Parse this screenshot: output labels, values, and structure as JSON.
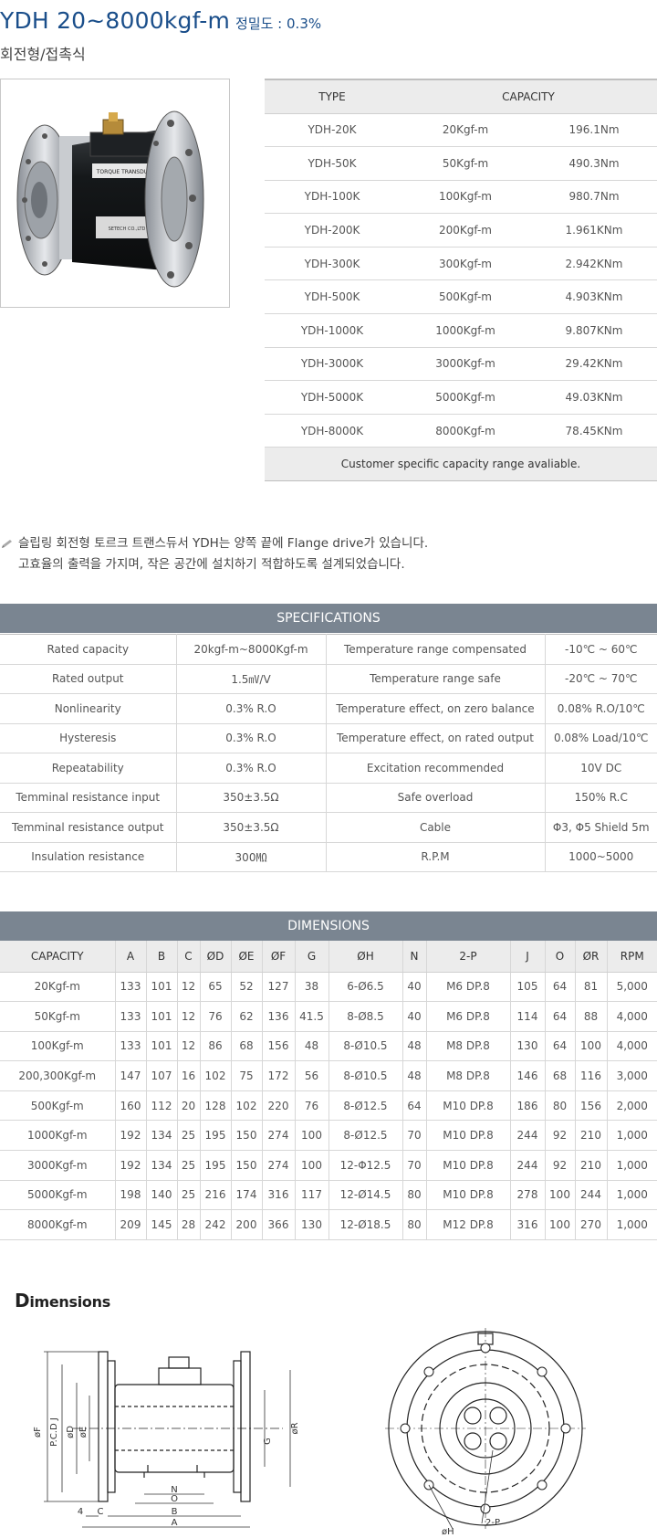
{
  "header": {
    "title": "YDH 20~8000kgf-m",
    "accuracy": "정밀도 : 0.3%",
    "subtitle": "회전형/접촉식"
  },
  "photo": {
    "label_top": "TORQUE TRANSDUCER",
    "label_bottom": "SETECH CO.,LTD"
  },
  "capacity_table": {
    "headers": [
      "TYPE",
      "CAPACITY"
    ],
    "rows": [
      [
        "YDH-20K",
        "20Kgf-m",
        "196.1Nm"
      ],
      [
        "YDH-50K",
        "50Kgf-m",
        "490.3Nm"
      ],
      [
        "YDH-100K",
        "100Kgf-m",
        "980.7Nm"
      ],
      [
        "YDH-200K",
        "200Kgf-m",
        "1.961KNm"
      ],
      [
        "YDH-300K",
        "300Kgf-m",
        "2.942KNm"
      ],
      [
        "YDH-500K",
        "500Kgf-m",
        "4.903KNm"
      ],
      [
        "YDH-1000K",
        "1000Kgf-m",
        "9.807KNm"
      ],
      [
        "YDH-3000K",
        "3000Kgf-m",
        "29.42KNm"
      ],
      [
        "YDH-5000K",
        "5000Kgf-m",
        "49.03KNm"
      ],
      [
        "YDH-8000K",
        "8000Kgf-m",
        "78.45KNm"
      ]
    ],
    "footer": "Customer specific capacity range avaliable."
  },
  "intro": {
    "line1": "슬립링 회전형 토르크 트랜스듀서 YDH는 양쪽 끝에 Flange drive가 있습니다.",
    "line2": "고효율의 출력을 가지며, 작은 공간에 설치하기 적합하도록 설계되었습니다."
  },
  "specifications": {
    "title": "SPECIFICATIONS",
    "rows": [
      [
        "Rated capacity",
        "20kgf-m~8000Kgf-m",
        "Temperature range compensated",
        "-10℃ ~ 60℃"
      ],
      [
        "Rated output",
        "1.5㎷/V",
        "Temperature range safe",
        "-20℃ ~ 70℃"
      ],
      [
        "Nonlinearity",
        "0.3% R.O",
        "Temperature effect, on zero balance",
        "0.08% R.O/10℃"
      ],
      [
        "Hysteresis",
        "0.3% R.O",
        "Temperature effect, on rated output",
        "0.08% Load/10℃"
      ],
      [
        "Repeatability",
        "0.3% R.O",
        "Excitation recommended",
        "10V DC"
      ],
      [
        "Temminal resistance input",
        "350±3.5Ω",
        "Safe overload",
        "150% R.C"
      ],
      [
        "Temminal resistance output",
        "350±3.5Ω",
        "Cable",
        "Φ3, Φ5 Shield 5m"
      ],
      [
        "Insulation resistance",
        "300㏁",
        "R.P.M",
        "1000~5000"
      ]
    ]
  },
  "dimensions": {
    "title": "DIMENSIONS",
    "headers": [
      "CAPACITY",
      "A",
      "B",
      "C",
      "ØD",
      "ØE",
      "ØF",
      "G",
      "ØH",
      "N",
      "2-P",
      "J",
      "O",
      "ØR",
      "RPM"
    ],
    "rows": [
      [
        "20Kgf-m",
        "133",
        "101",
        "12",
        "65",
        "52",
        "127",
        "38",
        "6-Ø6.5",
        "40",
        "M6 DP.8",
        "105",
        "64",
        "81",
        "5,000"
      ],
      [
        "50Kgf-m",
        "133",
        "101",
        "12",
        "76",
        "62",
        "136",
        "41.5",
        "8-Ø8.5",
        "40",
        "M6 DP.8",
        "114",
        "64",
        "88",
        "4,000"
      ],
      [
        "100Kgf-m",
        "133",
        "101",
        "12",
        "86",
        "68",
        "156",
        "48",
        "8-Ø10.5",
        "48",
        "M8 DP.8",
        "130",
        "64",
        "100",
        "4,000"
      ],
      [
        "200,300Kgf-m",
        "147",
        "107",
        "16",
        "102",
        "75",
        "172",
        "56",
        "8-Ø10.5",
        "48",
        "M8 DP.8",
        "146",
        "68",
        "116",
        "3,000"
      ],
      [
        "500Kgf-m",
        "160",
        "112",
        "20",
        "128",
        "102",
        "220",
        "76",
        "8-Ø12.5",
        "64",
        "M10 DP.8",
        "186",
        "80",
        "156",
        "2,000"
      ],
      [
        "1000Kgf-m",
        "192",
        "134",
        "25",
        "195",
        "150",
        "274",
        "100",
        "8-Ø12.5",
        "70",
        "M10 DP.8",
        "244",
        "92",
        "210",
        "1,000"
      ],
      [
        "3000Kgf-m",
        "192",
        "134",
        "25",
        "195",
        "150",
        "274",
        "100",
        "12-Φ12.5",
        "70",
        "M10 DP.8",
        "244",
        "92",
        "210",
        "1,000"
      ],
      [
        "5000Kgf-m",
        "198",
        "140",
        "25",
        "216",
        "174",
        "316",
        "117",
        "12-Ø14.5",
        "80",
        "M10 DP.8",
        "278",
        "100",
        "244",
        "1,000"
      ],
      [
        "8000Kgf-m",
        "209",
        "145",
        "28",
        "242",
        "200",
        "366",
        "130",
        "12-Ø18.5",
        "80",
        "M12 DP.8",
        "316",
        "100",
        "270",
        "1,000"
      ]
    ]
  },
  "drawing": {
    "heading_big": "D",
    "heading_rest": "imensions",
    "labels": {
      "F": "øF",
      "PCD": "P.C.D J",
      "D": "øD",
      "E": "øE",
      "G": "G",
      "R": "øR",
      "N": "N",
      "O": "O",
      "B": "B",
      "A": "A",
      "C": "C",
      "four": "4",
      "H": "øH",
      "P": "2-P"
    }
  }
}
